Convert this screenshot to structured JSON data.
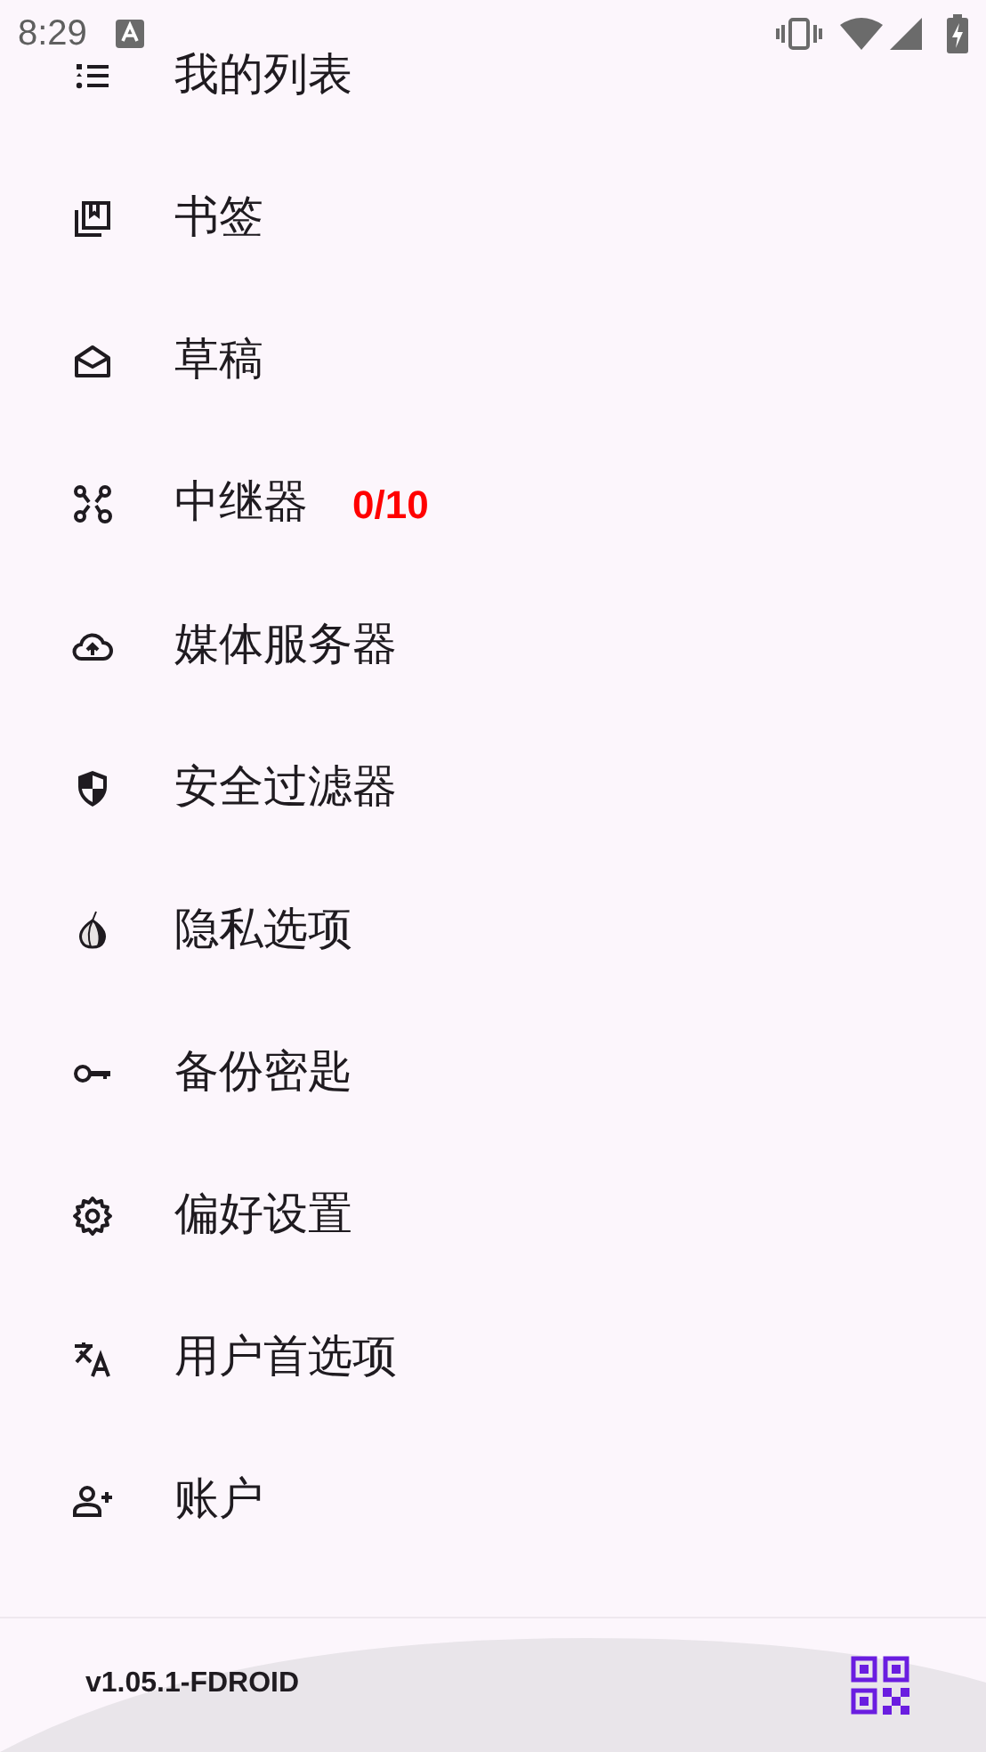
{
  "status_bar": {
    "time": "8:29"
  },
  "menu": {
    "items": [
      {
        "label": "我的列表"
      },
      {
        "label": "书签"
      },
      {
        "label": "草稿"
      },
      {
        "label": "中继器",
        "badge": "0/10"
      },
      {
        "label": "媒体服务器"
      },
      {
        "label": "安全过滤器"
      },
      {
        "label": "隐私选项"
      },
      {
        "label": "备份密匙"
      },
      {
        "label": "偏好设置"
      },
      {
        "label": "用户首选项"
      },
      {
        "label": "账户"
      }
    ]
  },
  "footer": {
    "version": "v1.05.1-FDROID"
  }
}
